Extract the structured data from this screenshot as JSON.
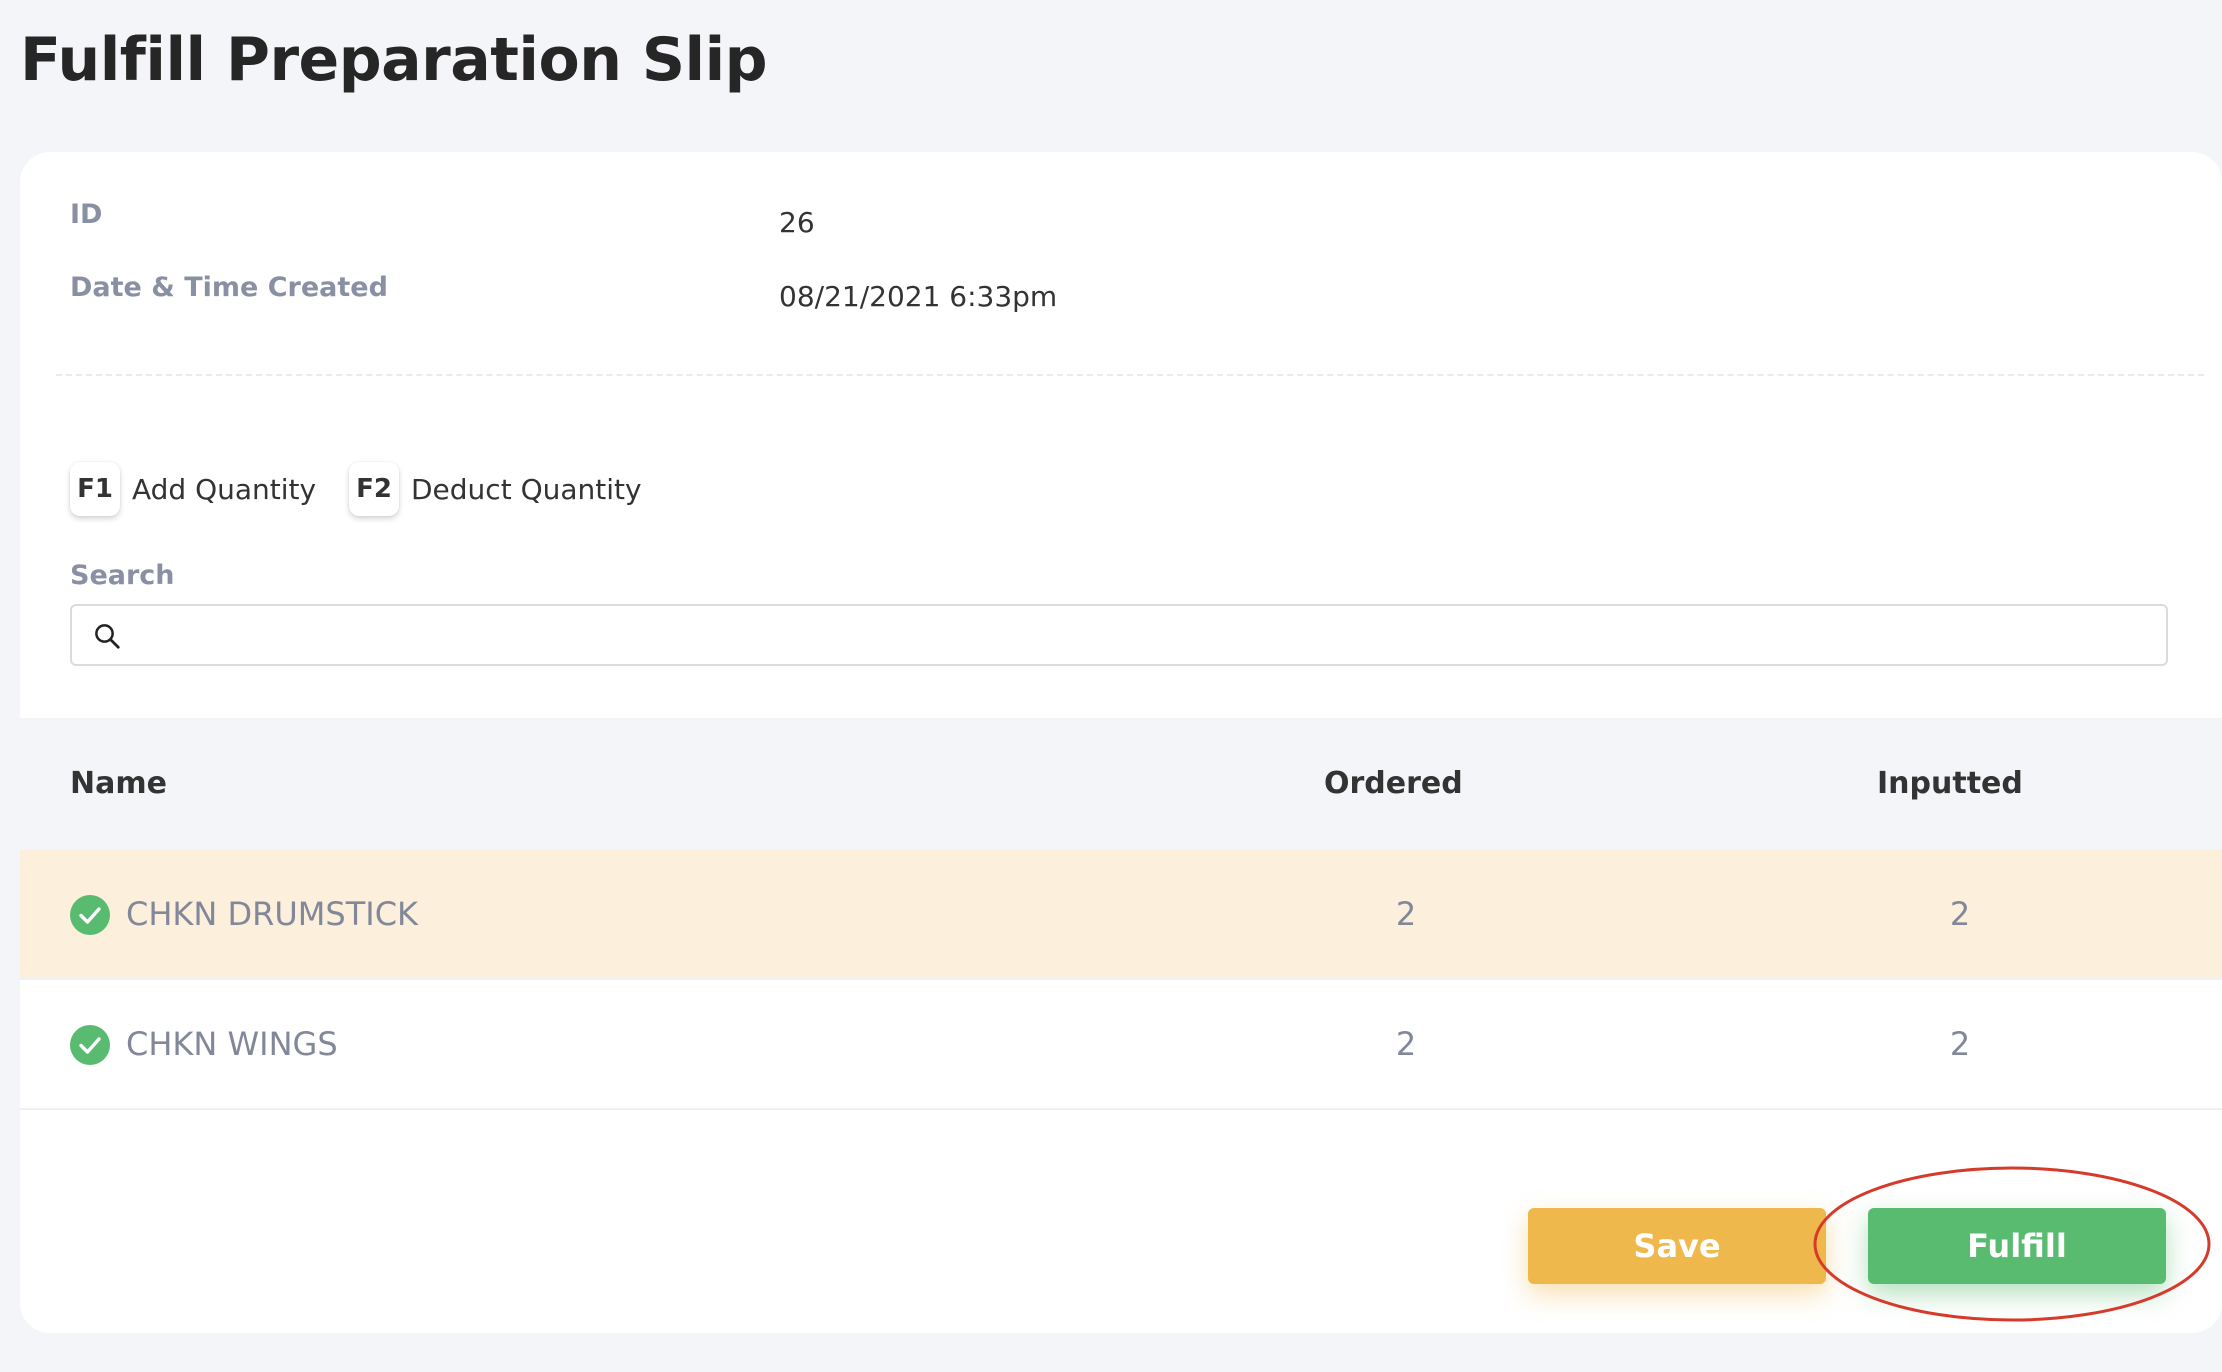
{
  "page": {
    "title": "Fulfill Preparation Slip"
  },
  "details": {
    "id_label": "ID",
    "id_value": "26",
    "created_label": "Date & Time Created",
    "created_value": "08/21/2021 6:33pm"
  },
  "shortcuts": [
    {
      "key": "F1",
      "label": "Add Quantity"
    },
    {
      "key": "F2",
      "label": "Deduct Quantity"
    }
  ],
  "search": {
    "label": "Search",
    "value": "",
    "placeholder": "",
    "icon": "search-icon"
  },
  "table": {
    "columns": [
      "Name",
      "Ordered",
      "Inputted"
    ],
    "rows": [
      {
        "name": "CHKN DRUMSTICK",
        "ordered": "2",
        "inputted": "2",
        "status_icon": "check-circle-icon",
        "highlighted": true
      },
      {
        "name": "CHKN WINGS",
        "ordered": "2",
        "inputted": "2",
        "status_icon": "check-circle-icon",
        "highlighted": false
      }
    ]
  },
  "actions": {
    "save_label": "Save",
    "fulfill_label": "Fulfill"
  },
  "colors": {
    "save": "#efb84d",
    "fulfill": "#58bb6f",
    "highlight_row": "#fcf0dc",
    "check": "#58bb6f",
    "annotation": "#d63a2a"
  }
}
